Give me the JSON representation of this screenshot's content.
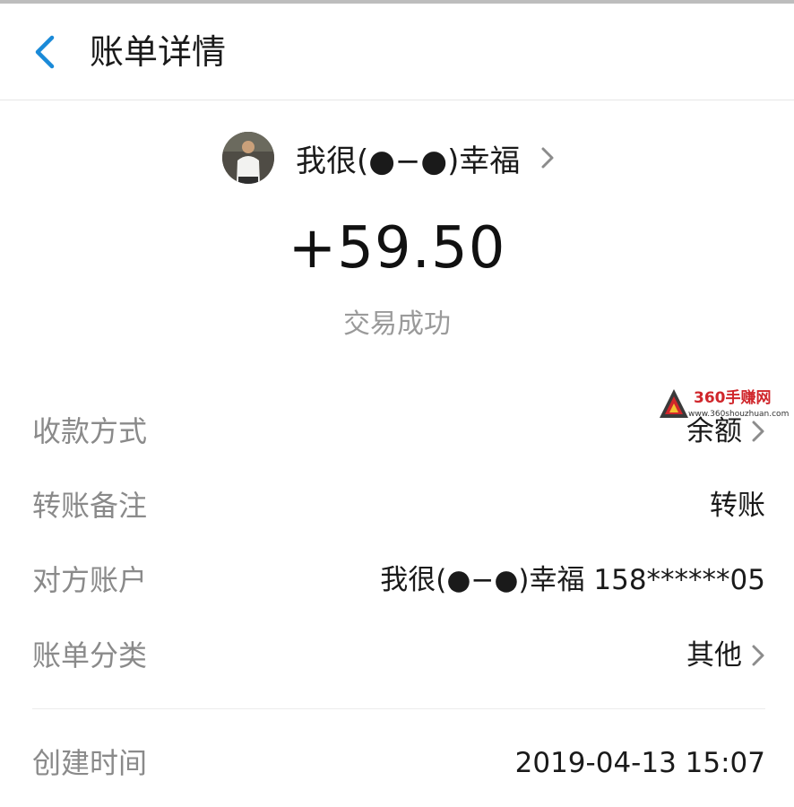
{
  "header": {
    "back_icon": "chevron-left-icon",
    "title": "账单详情",
    "accent_color": "#1a8ad8"
  },
  "counterparty": {
    "avatar": "avatar-photo",
    "name": "我很(●−●)幸福",
    "chevron_icon": "chevron-right-icon"
  },
  "amount": "+59.50",
  "status": "交易成功",
  "details": [
    {
      "label": "收款方式",
      "value": "余额",
      "has_chevron": true
    },
    {
      "label": "转账备注",
      "value": "转账",
      "has_chevron": false
    },
    {
      "label": "对方账户",
      "value": "我很(●−●)幸福 158******05",
      "has_chevron": false
    },
    {
      "label": "账单分类",
      "value": "其他",
      "has_chevron": true
    }
  ],
  "created": {
    "label": "创建时间",
    "value": "2019-04-13 15:07"
  },
  "watermark": {
    "brand": "360手赚网",
    "url": "www.360shouzhuan.com"
  }
}
